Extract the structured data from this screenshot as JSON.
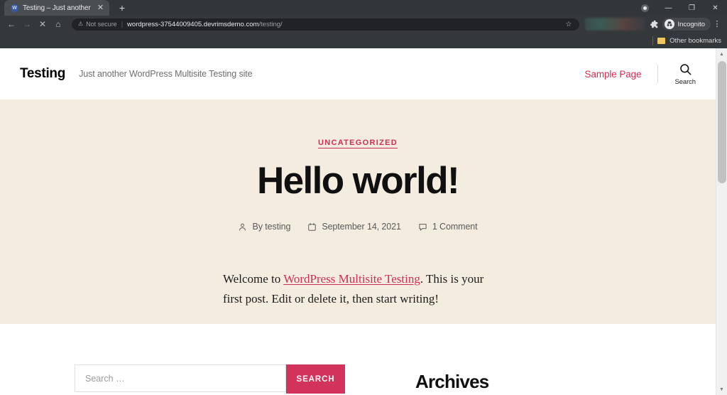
{
  "browser": {
    "tab": {
      "title": "Testing – Just another WordPress",
      "favicon_letter": "W",
      "favicon_name": "wordpress-favicon",
      "close_glyph": "✕"
    },
    "new_tab_glyph": "+",
    "window_controls": {
      "record_name": "record-indicator",
      "minimize": "—",
      "maximize": "❐",
      "close": "✕"
    },
    "toolbar": {
      "back_glyph": "←",
      "forward_glyph": "→",
      "stop_glyph": "✕",
      "home_glyph": "⌂",
      "security_glyph": "⚠",
      "security_label": "Not secure",
      "separator": "|",
      "url_host": "wordpress-37544009405.devrimsdemo.com",
      "url_path": "/testing/",
      "bookmark_star_glyph": "☆",
      "extensions_glyph": "🧩",
      "profile_label": "Incognito",
      "profile_glyph": "👤",
      "menu_glyph": "⋮"
    },
    "bookmarks_bar": {
      "other_bookmarks_label": "Other bookmarks"
    }
  },
  "site": {
    "title": "Testing",
    "tagline": "Just another WordPress Multisite Testing site",
    "nav": {
      "sample_page": "Sample Page",
      "search_label": "Search"
    }
  },
  "post": {
    "category": "UNCATEGORIZED",
    "title": "Hello world!",
    "meta": {
      "author": "By testing",
      "date": "September 14, 2021",
      "comments": "1 Comment"
    },
    "body": {
      "lead": "Welcome to ",
      "link": "WordPress Multisite Testing",
      "rest": ". This is your first post. Edit or delete it, then start writing!"
    }
  },
  "widgets": {
    "search": {
      "placeholder": "Search …",
      "button_label": "SEARCH"
    },
    "archives_title": "Archives"
  },
  "colors": {
    "accent_pink": "#cf2e55",
    "button_crimson": "#d2335c",
    "hero_cream": "#f3ecdf",
    "chrome_dark": "#35383b"
  },
  "scrollbar": {
    "up_glyph": "▲",
    "down_glyph": "▼"
  }
}
